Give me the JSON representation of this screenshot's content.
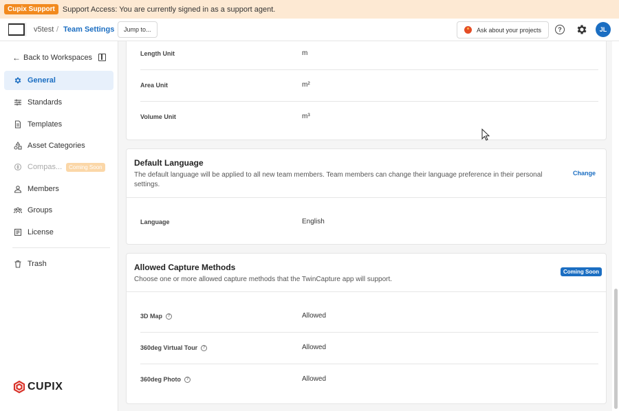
{
  "banner": {
    "badge": "Cupix Support",
    "text": "Support Access: You are currently signed in as a support agent."
  },
  "header": {
    "workspace": "v5test",
    "separator": "/",
    "page": "Team Settings",
    "jump_label": "Jump to...",
    "ask_label": "Ask about your projects",
    "avatar_initials": "JL"
  },
  "sidebar": {
    "back_label": "Back to Workspaces",
    "items": [
      {
        "label": "General",
        "icon": "gear-icon"
      },
      {
        "label": "Standards",
        "icon": "sliders-icon"
      },
      {
        "label": "Templates",
        "icon": "document-icon"
      },
      {
        "label": "Asset Categories",
        "icon": "shapes-icon"
      },
      {
        "label": "Compas...",
        "icon": "compass-icon",
        "badge": "Coming Soon"
      },
      {
        "label": "Members",
        "icon": "user-icon"
      },
      {
        "label": "Groups",
        "icon": "group-icon"
      },
      {
        "label": "License",
        "icon": "license-icon"
      },
      {
        "label": "Trash",
        "icon": "trash-icon"
      }
    ],
    "brand": "CUPIX"
  },
  "units": {
    "rows": [
      {
        "label": "Length Unit",
        "value": "m"
      },
      {
        "label": "Area Unit",
        "value": "m²"
      },
      {
        "label": "Volume Unit",
        "value": "m³"
      }
    ]
  },
  "language": {
    "title": "Default Language",
    "description": "The default language will be applied to all new team members. Team members can change their language preference in their personal settings.",
    "change_label": "Change",
    "row_label": "Language",
    "row_value": "English"
  },
  "capture": {
    "title": "Allowed Capture Methods",
    "description": "Choose one or more allowed capture methods that the TwinCapture app will support.",
    "badge": "Coming Soon",
    "rows": [
      {
        "label": "3D Map",
        "value": "Allowed"
      },
      {
        "label": "360deg Virtual Tour",
        "value": "Allowed"
      },
      {
        "label": "360deg Photo",
        "value": "Allowed"
      }
    ]
  },
  "colors": {
    "accent": "#1b6ec2",
    "banner_bg": "#fde9d3",
    "banner_badge": "#f28a1e"
  }
}
